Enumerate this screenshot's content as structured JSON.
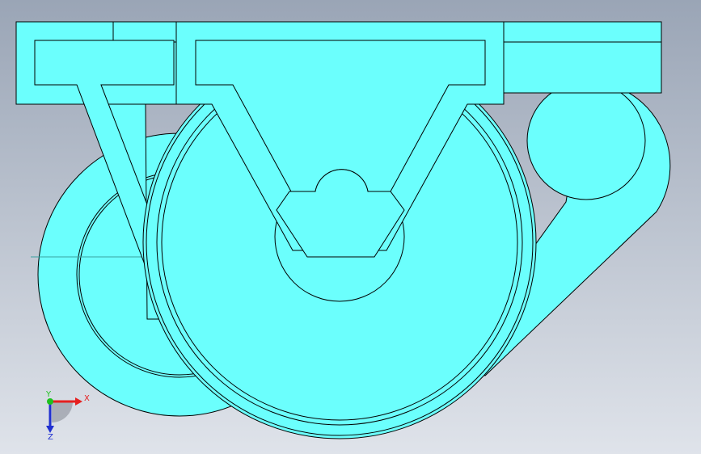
{
  "viewport": {
    "background_top": "#9aa5b6",
    "background_bottom": "#dfe3ea",
    "part_fill": "#6bfffd",
    "edge_color": "#000000"
  },
  "triad": {
    "x_label": "X",
    "y_label": "Y",
    "z_label": "Z",
    "x_color": "#e62020",
    "y_color": "#1fc21f",
    "z_color": "#2030d0"
  }
}
